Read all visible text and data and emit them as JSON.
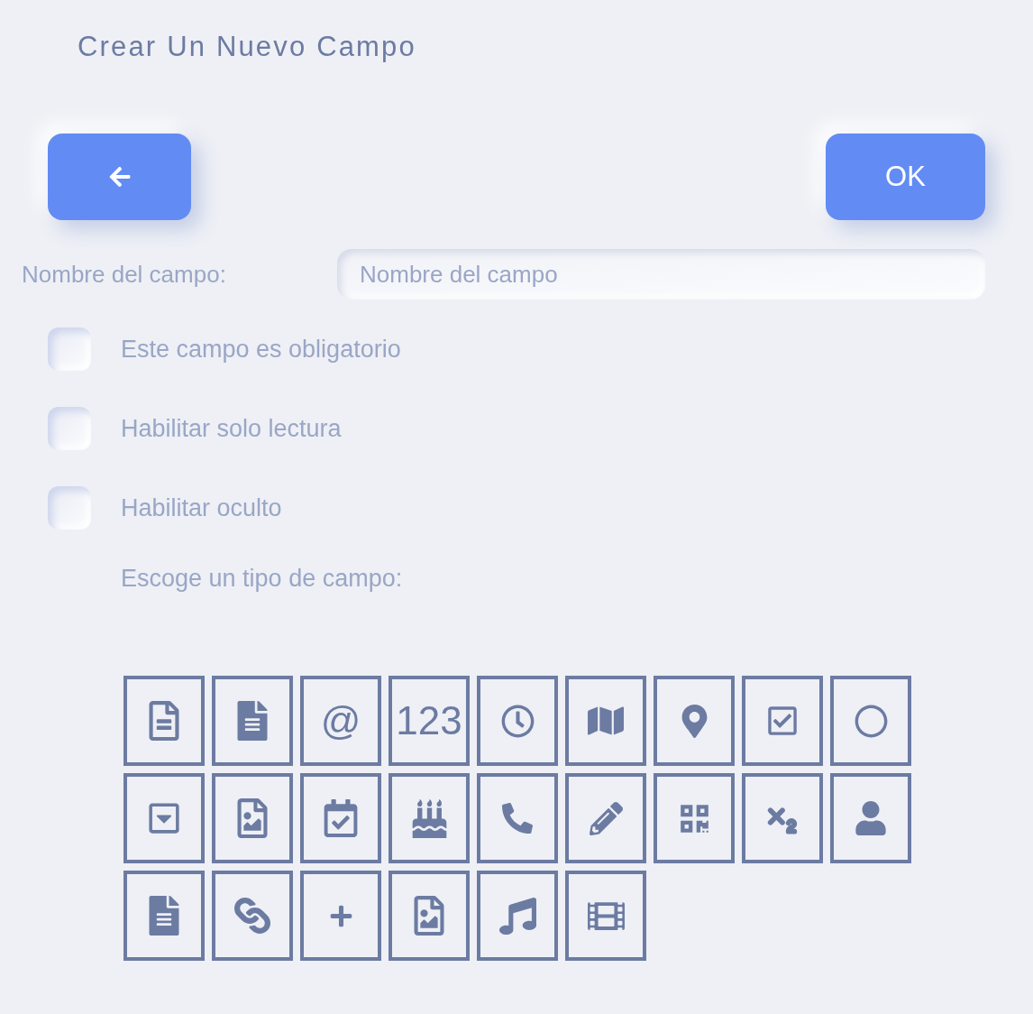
{
  "title": "Crear Un Nuevo Campo",
  "toolbar": {
    "ok_button": "OK"
  },
  "field_name": {
    "label": "Nombre del campo:",
    "placeholder": "Nombre del campo"
  },
  "options": [
    {
      "label": "Este campo es obligatorio",
      "checked": false
    },
    {
      "label": "Habilitar solo lectura",
      "checked": false
    },
    {
      "label": "Habilitar oculto",
      "checked": false
    }
  ],
  "field_type_prompt": "Escoge un tipo de campo:",
  "field_types": [
    {
      "kind": "document"
    },
    {
      "kind": "sheet"
    },
    {
      "kind": "text",
      "text": "@"
    },
    {
      "kind": "text",
      "text": "123"
    },
    {
      "kind": "clock"
    },
    {
      "kind": "map"
    },
    {
      "kind": "pin"
    },
    {
      "kind": "checkbox"
    },
    {
      "kind": "circle"
    },
    {
      "kind": "dropdown"
    },
    {
      "kind": "image"
    },
    {
      "kind": "calendar"
    },
    {
      "kind": "cake"
    },
    {
      "kind": "phone"
    },
    {
      "kind": "pencil"
    },
    {
      "kind": "qrcode"
    },
    {
      "kind": "subscript"
    },
    {
      "kind": "user"
    },
    {
      "kind": "sheet"
    },
    {
      "kind": "link"
    },
    {
      "kind": "plus"
    },
    {
      "kind": "image"
    },
    {
      "kind": "music"
    },
    {
      "kind": "film"
    }
  ]
}
